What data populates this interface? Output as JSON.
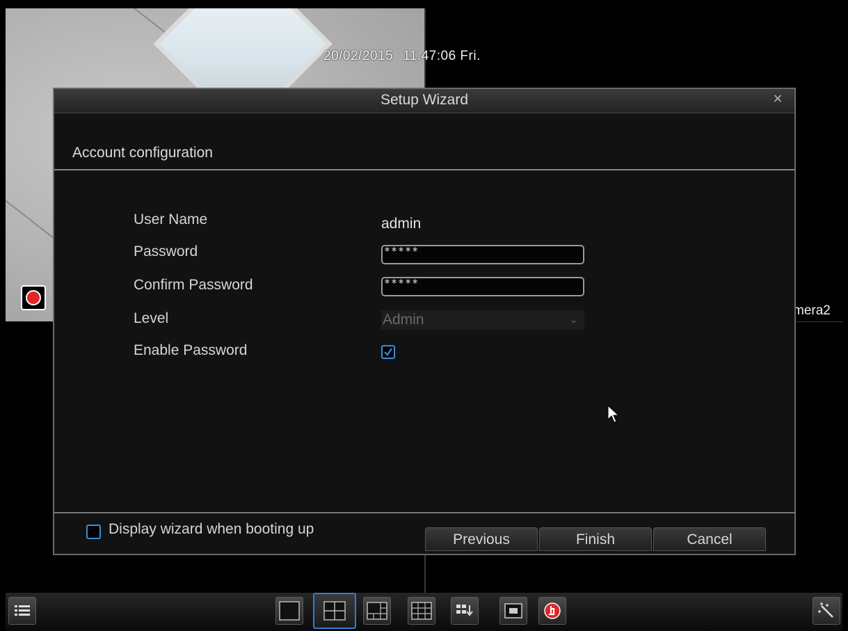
{
  "osd": {
    "date": "20/02/2015",
    "time": "11:47:06 Fri.",
    "camera2_label": "mera2"
  },
  "dialog": {
    "title": "Setup Wizard",
    "close_symbol": "×",
    "section_title": "Account configuration",
    "fields": {
      "user_name_label": "User Name",
      "user_name_value": "admin",
      "password_label": "Password",
      "password_value": "*****",
      "confirm_password_label": "Confirm Password",
      "confirm_password_value": "*****",
      "level_label": "Level",
      "level_value": "Admin",
      "enable_password_label": "Enable Password",
      "enable_password_checked": true
    },
    "footer": {
      "display_wizard_label": "Display wizard when booting up",
      "display_wizard_checked": false,
      "previous_label": "Previous",
      "finish_label": "Finish",
      "cancel_label": "Cancel"
    }
  },
  "taskbar": {
    "selected_layout": "4-split",
    "icons": [
      "menu-icon",
      "layout-1-icon",
      "layout-4-icon",
      "layout-6-icon",
      "layout-9-icon",
      "sequence-icon",
      "pip-icon",
      "manual-record-icon",
      "wizard-icon"
    ]
  },
  "colors": {
    "accent": "#2c7fd2",
    "record": "#e2262a"
  }
}
